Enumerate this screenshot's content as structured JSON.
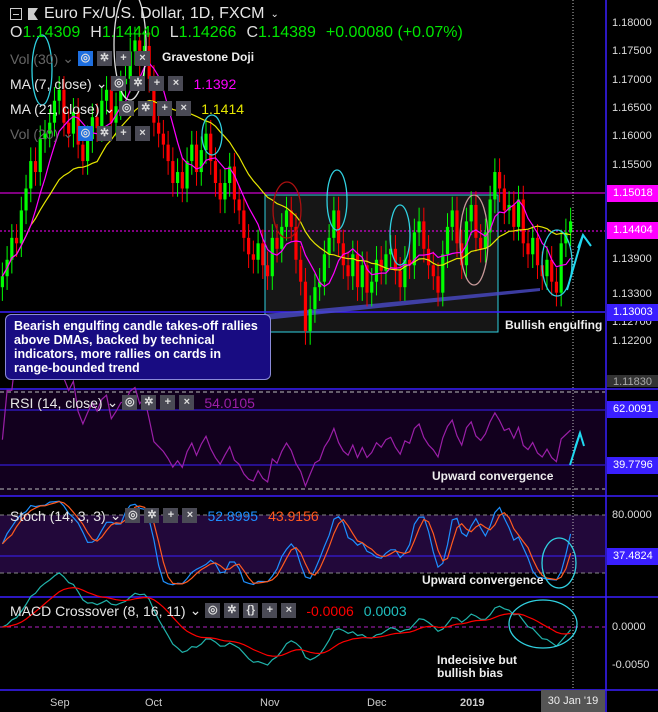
{
  "header": {
    "title": "Euro Fx/U.S. Dollar, 1D, FXCM",
    "o_label": "O",
    "o": "1.14309",
    "h_label": "H",
    "h": "1.14440",
    "l_label": "L",
    "l": "1.14266",
    "c_label": "C",
    "c": "1.14389",
    "change": "+0.00080 (+0.07%)"
  },
  "legends": {
    "vol30": "Vol (30)",
    "ma7": "MA (7, close)",
    "ma7_value": "1.1392",
    "ma21": "MA (21, close)",
    "ma21_value": "1.1414",
    "vol20": "Vol (20)",
    "rsi": "RSI (14, close)",
    "rsi_value": "54.0105",
    "stoch": "Stoch (14, 3, 3)",
    "stoch_k": "52.8995",
    "stoch_d": "43.9156",
    "macd": "MACD Crossover (8, 16, 11)",
    "macd_value": "-0.0006",
    "macd_signal": "0.0003"
  },
  "annotations": {
    "doji": "Gravestone Doji",
    "bullish": "Bullish engulfing",
    "box": "Bearish engulfing candle takes-off rallies above DMAs, backed by technical indicators, more rallies on cards in range-bounded trend",
    "rsi_note": "Upward convergence",
    "stoch_note": "Upward convergence",
    "macd_note1": "Indecisive but",
    "macd_note2": "bullish bias"
  },
  "colors": {
    "up": "#00ff00",
    "down": "#ff0000",
    "ma7": "#ff00ff",
    "ma21": "#e6e600",
    "rsi": "#9b1fa8",
    "stoch_k": "#1e8fff",
    "stoch_d": "#ff5a1f",
    "macd": "#20b2aa",
    "signal": "#ff0000",
    "level": "#3a1fff",
    "resistance": "#ff00ff"
  },
  "chart_data": {
    "type": "candlestick",
    "price_axis_labels": [
      "1.18000",
      "1.17500",
      "1.17000",
      "1.16500",
      "1.16000",
      "1.15500",
      "1.13900",
      "1.13300",
      "1.12700",
      "1.12200"
    ],
    "price_tags": {
      "resistance": "1.15018",
      "current": "1.14404",
      "support": "1.13003",
      "low": "1.11830"
    },
    "rsi_levels": [
      "62.0091",
      "39.7796"
    ],
    "stoch_levels": [
      "80.0000",
      "37.4824"
    ],
    "macd_levels": [
      "0.0000",
      "-0.0050"
    ],
    "x_tick_labels": [
      "Sep",
      "Oct",
      "Nov",
      "Dec",
      "2019"
    ],
    "crosshair_date": "30 Jan '19",
    "close": [
      1.134,
      1.137,
      1.141,
      1.14,
      1.146,
      1.15,
      1.155,
      1.153,
      1.159,
      1.16,
      1.162,
      1.166,
      1.168,
      1.162,
      1.16,
      1.164,
      1.158,
      1.155,
      1.159,
      1.163,
      1.161,
      1.166,
      1.168,
      1.162,
      1.165,
      1.169,
      1.17,
      1.175,
      1.177,
      1.173,
      1.176,
      1.17,
      1.162,
      1.16,
      1.158,
      1.155,
      1.151,
      1.153,
      1.15,
      1.155,
      1.158,
      1.153,
      1.157,
      1.16,
      1.155,
      1.151,
      1.148,
      1.151,
      1.154,
      1.148,
      1.146,
      1.141,
      1.138,
      1.137,
      1.14,
      1.136,
      1.134,
      1.141,
      1.139,
      1.143,
      1.146,
      1.143,
      1.137,
      1.133,
      1.124,
      1.128,
      1.132,
      1.133,
      1.138,
      1.141,
      1.146,
      1.14,
      1.136,
      1.134,
      1.138,
      1.132,
      1.136,
      1.131,
      1.133,
      1.137,
      1.135,
      1.138,
      1.139,
      1.135,
      1.132,
      1.137,
      1.136,
      1.142,
      1.144,
      1.139,
      1.136,
      1.134,
      1.131,
      1.138,
      1.143,
      1.146,
      1.14,
      1.136,
      1.144,
      1.147,
      1.141,
      1.139,
      1.142,
      1.148,
      1.153,
      1.15,
      1.146,
      1.147,
      1.143,
      1.148,
      1.14,
      1.138,
      1.141,
      1.136,
      1.134,
      1.137,
      1.133,
      1.131,
      1.14,
      1.142,
      1.144
    ]
  }
}
